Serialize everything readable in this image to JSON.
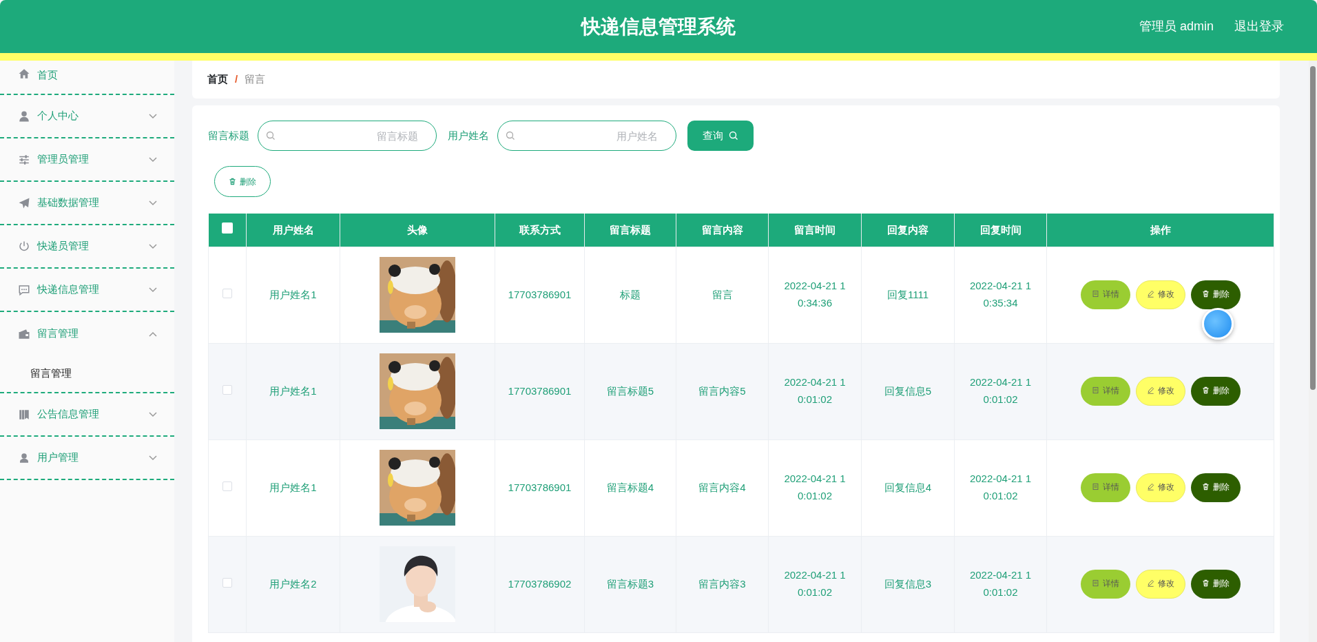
{
  "header": {
    "title": "快递信息管理系统",
    "user_label": "管理员 admin",
    "logout": "退出登录"
  },
  "sidebar": {
    "items": [
      {
        "label": "首页"
      },
      {
        "label": "个人中心",
        "expanded": false
      },
      {
        "label": "管理员管理",
        "expanded": false
      },
      {
        "label": "基础数据管理",
        "expanded": false
      },
      {
        "label": "快递员管理",
        "expanded": false
      },
      {
        "label": "快递信息管理",
        "expanded": false
      },
      {
        "label": "留言管理",
        "expanded": true,
        "children": [
          {
            "label": "留言管理"
          }
        ]
      },
      {
        "label": "公告信息管理",
        "expanded": false
      },
      {
        "label": "用户管理",
        "expanded": false
      }
    ]
  },
  "breadcrumb": {
    "items": [
      {
        "label": "首页",
        "current": false
      },
      {
        "label": "留言",
        "current": true
      }
    ],
    "separator": "/"
  },
  "search": {
    "fields": [
      {
        "label": "留言标题",
        "placeholder": "留言标题"
      },
      {
        "label": "用户姓名",
        "placeholder": "用户姓名"
      }
    ],
    "button": "查询"
  },
  "toolbar": {
    "delete_button": "删除"
  },
  "table": {
    "select_all": {
      "checked": false
    },
    "columns": [
      "用户姓名",
      "头像",
      "联系方式",
      "留言标题",
      "留言内容",
      "留言时间",
      "回复内容",
      "回复时间",
      "操作"
    ],
    "rows": [
      {
        "checked": false,
        "name": "用户姓名1",
        "avatar": {
          "kind": "cat"
        },
        "contact": "17703786901",
        "title": "标题",
        "content": "留言",
        "time": "2022-04-21 10:34:36",
        "reply": "回复1111",
        "reply_time": "2022-04-21 10:35:34",
        "actions": [
          "详情",
          "修改",
          "删除"
        ]
      },
      {
        "checked": false,
        "name": "用户姓名1",
        "avatar": {
          "kind": "cat"
        },
        "contact": "17703786901",
        "title": "留言标题5",
        "content": "留言内容5",
        "time": "2022-04-21 10:01:02",
        "reply": "回复信息5",
        "reply_time": "2022-04-21 10:01:02",
        "actions": [
          "详情",
          "修改",
          "删除"
        ]
      },
      {
        "checked": false,
        "name": "用户姓名1",
        "avatar": {
          "kind": "cat"
        },
        "contact": "17703786901",
        "title": "留言标题4",
        "content": "留言内容4",
        "time": "2022-04-21 10:01:02",
        "reply": "回复信息4",
        "reply_time": "2022-04-21 10:01:02",
        "actions": [
          "详情",
          "修改",
          "删除"
        ]
      },
      {
        "checked": false,
        "name": "用户姓名2",
        "avatar": {
          "kind": "person"
        },
        "contact": "17703786902",
        "title": "留言标题3",
        "content": "留言内容3",
        "time": "2022-04-21 10:01:02",
        "reply": "回复信息3",
        "reply_time": "2022-04-21 10:01:02",
        "actions": [
          "详情",
          "修改",
          "删除"
        ]
      }
    ]
  }
}
